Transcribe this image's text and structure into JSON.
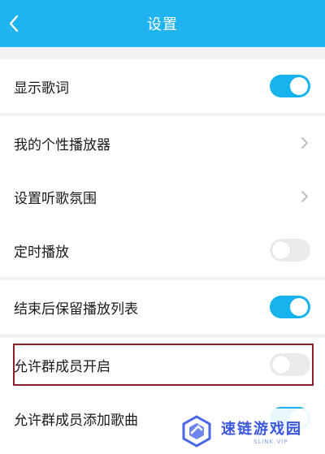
{
  "header": {
    "title": "设置"
  },
  "colors": {
    "accent": "#1fb3f0",
    "toggle_on": "#16b3ef",
    "toggle_off": "#ebebeb",
    "highlight_border": "#8c1f2a"
  },
  "settings": {
    "show_lyrics": {
      "label": "显示歌词",
      "enabled": true
    },
    "personal_player": {
      "label": "我的个性播放器",
      "icon": "chevron-right-icon"
    },
    "listening_atmosphere": {
      "label": "设置听歌氛围",
      "icon": "chevron-right-icon"
    },
    "timed_play": {
      "label": "定时播放",
      "enabled": false
    },
    "keep_playlist": {
      "label": "结束后保留播放列表",
      "enabled": true
    },
    "allow_members_open": {
      "label": "允许群成员开启",
      "enabled": false
    },
    "allow_members_add": {
      "label": "允许群成员添加歌曲",
      "enabled": true
    }
  },
  "watermark": {
    "text": "速链游戏园",
    "subtext": "SLINK.VIP"
  }
}
